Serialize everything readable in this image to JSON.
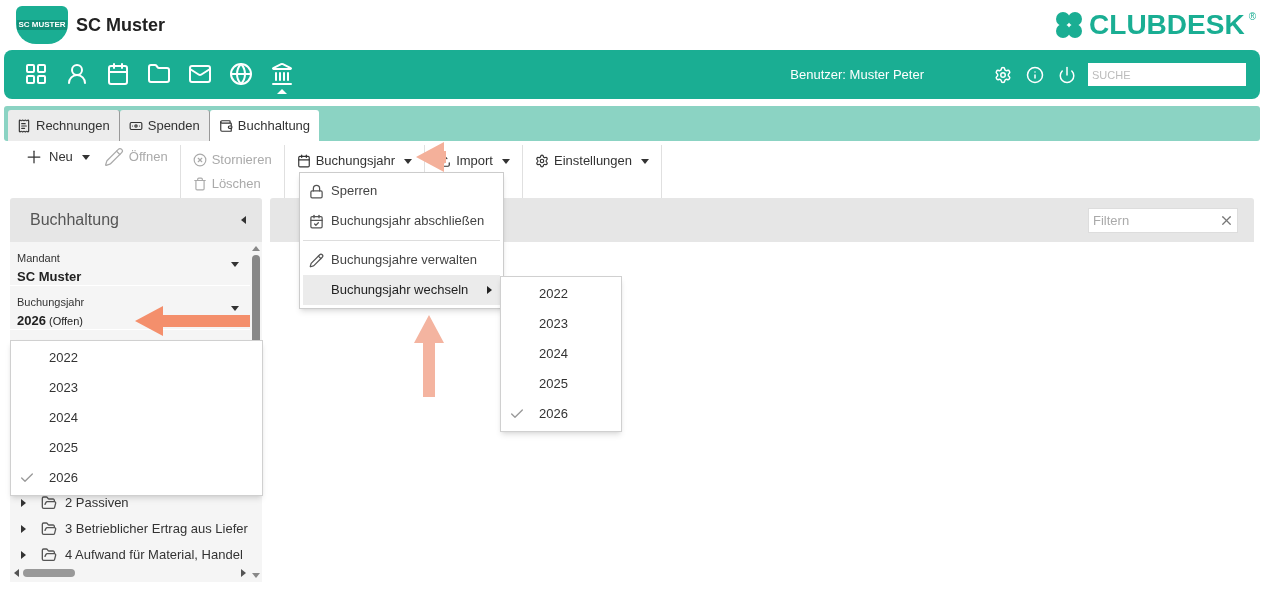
{
  "header": {
    "club_logo_text": "SC MUSTER",
    "club_name": "SC Muster",
    "brand": "CLUBDESK",
    "brand_mark": "®"
  },
  "nav": {
    "items": [
      {
        "kind": "dashboard",
        "selected": false
      },
      {
        "kind": "person",
        "selected": false
      },
      {
        "kind": "calendar",
        "selected": false
      },
      {
        "kind": "folder",
        "selected": false
      },
      {
        "kind": "mail",
        "selected": false
      },
      {
        "kind": "globe",
        "selected": false
      },
      {
        "kind": "bank",
        "selected": true
      }
    ],
    "user": "Benutzer: Muster Peter",
    "search": {
      "placeholder": "SUCHE"
    }
  },
  "tabs": [
    {
      "label": "Rechnungen",
      "kind": "invoice",
      "selected": false
    },
    {
      "label": "Spenden",
      "kind": "donation",
      "selected": false
    },
    {
      "label": "Buchhaltung",
      "kind": "wallet",
      "selected": true
    }
  ],
  "toolbar": {
    "groups": [
      [
        {
          "label": "Neu",
          "kind": "plus",
          "dropdown": true,
          "disabled": false
        },
        {
          "label": "Öffnen",
          "kind": "pencil",
          "dropdown": false,
          "disabled": true
        }
      ],
      [
        {
          "label": "Stornieren",
          "kind": "cancel",
          "dropdown": false,
          "disabled": true
        },
        {
          "label": "Löschen",
          "kind": "trash",
          "dropdown": false,
          "disabled": true
        }
      ],
      [
        {
          "label": "Buchungsjahr",
          "kind": "calendar",
          "dropdown": true,
          "disabled": false
        }
      ],
      [
        {
          "label": "Import",
          "kind": "upload",
          "dropdown": true,
          "disabled": false
        }
      ],
      [
        {
          "label": "Einstellungen",
          "kind": "gear",
          "dropdown": true,
          "disabled": false
        }
      ]
    ]
  },
  "menu": {
    "items": [
      {
        "label": "Sperren",
        "kind": "lock",
        "highlighted": false,
        "submenu": false
      },
      {
        "label": "Buchungsjahr abschließen",
        "kind": "calendar-check",
        "highlighted": false,
        "submenu": false
      },
      {
        "kind": "separator"
      },
      {
        "label": "Buchungsjahre verwalten",
        "kind": "pencil",
        "highlighted": false,
        "submenu": false
      },
      {
        "label": "Buchungsjahr wechseln",
        "kind": "none",
        "highlighted": true,
        "submenu": true
      }
    ],
    "submenu": [
      {
        "label": "2022",
        "checked": false
      },
      {
        "label": "2023",
        "checked": false
      },
      {
        "label": "2024",
        "checked": false
      },
      {
        "label": "2025",
        "checked": false
      },
      {
        "label": "2026",
        "checked": true
      }
    ]
  },
  "sidebar": {
    "title": "Buchhaltung",
    "fields": [
      {
        "label": "Mandant",
        "value": "SC Muster"
      },
      {
        "label": "Buchungsjahr",
        "value": "2026",
        "note": "(Offen)"
      }
    ],
    "year_dropdown": [
      {
        "label": "2022",
        "checked": false
      },
      {
        "label": "2023",
        "checked": false
      },
      {
        "label": "2024",
        "checked": false
      },
      {
        "label": "2025",
        "checked": false
      },
      {
        "label": "2026",
        "checked": true
      }
    ],
    "tree": [
      {
        "label": "2 Passiven",
        "expanded": false
      },
      {
        "label": "3 Betrieblicher Ertrag aus Liefer",
        "expanded": false
      },
      {
        "label": "4 Aufwand für Material, Handel",
        "expanded": false
      }
    ]
  },
  "main": {
    "filter": {
      "placeholder": "Filtern"
    }
  }
}
